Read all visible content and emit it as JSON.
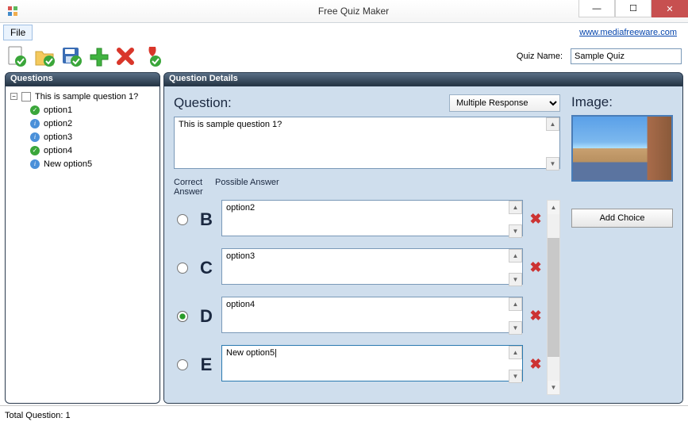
{
  "window": {
    "title": "Free Quiz Maker"
  },
  "menu": {
    "file": "File"
  },
  "link": {
    "url_text": "www.mediafreeware.com"
  },
  "toolbar": {
    "quiz_name_label": "Quiz Name:"
  },
  "quiz": {
    "name": "Sample Quiz"
  },
  "tree": {
    "header": "Questions",
    "root": "This is sample question 1?",
    "children": [
      {
        "label": "option1",
        "icon": "check"
      },
      {
        "label": "option2",
        "icon": "info"
      },
      {
        "label": "option3",
        "icon": "info"
      },
      {
        "label": "option4",
        "icon": "check"
      },
      {
        "label": "New option5",
        "icon": "info"
      }
    ]
  },
  "details": {
    "header": "Question Details",
    "question_label": "Question:",
    "question_text": "This is sample question 1?",
    "type_options": [
      "Multiple Response"
    ],
    "type_selected": "Multiple Response",
    "correct_label": "Correct\nAnswer",
    "possible_label": "Possible Answer",
    "answers": [
      {
        "letter": "B",
        "text": "option2",
        "correct": false
      },
      {
        "letter": "C",
        "text": "option3",
        "correct": false
      },
      {
        "letter": "D",
        "text": "option4",
        "correct": true
      },
      {
        "letter": "E",
        "text": "New option5",
        "correct": false,
        "active": true
      }
    ],
    "image_label": "Image:",
    "add_choice": "Add Choice"
  },
  "status": {
    "total_label": "Total Question:",
    "total_value": "1"
  }
}
